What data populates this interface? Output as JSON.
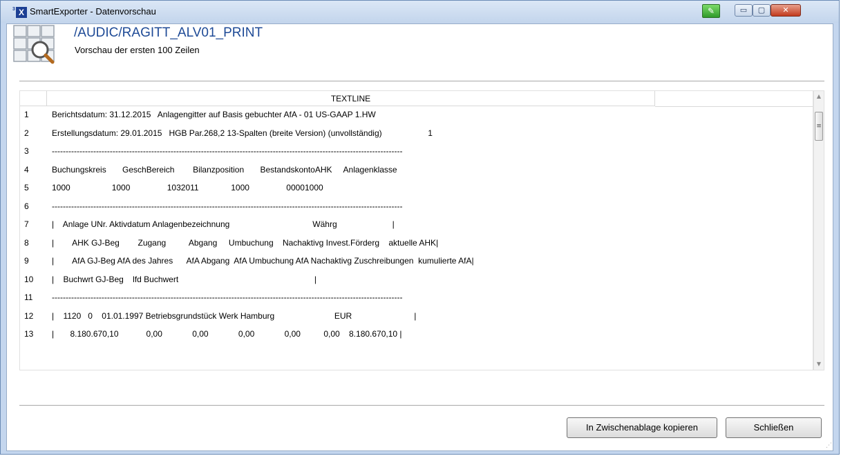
{
  "window": {
    "title": "SmartExporter - Datenvorschau",
    "icons": {
      "app": "smartexporter-logo-icon",
      "edit": "edit-green-icon"
    },
    "controls": {
      "minimize": "▭",
      "maximize": "▢",
      "close": "✕"
    }
  },
  "header": {
    "title": "/AUDIC/RAGITT_ALV01_PRINT",
    "subtitle": "Vorschau der ersten 100 Zeilen",
    "icon": "table-preview-magnifier-icon"
  },
  "grid": {
    "column_header": "TEXTLINE",
    "rows": [
      {
        "num": "1",
        "text": "Berichtsdatum: 31.12.2015   Anlagengitter auf Basis gebuchter AfA - 01 US-GAAP 1.HW"
      },
      {
        "num": "2",
        "text": "Erstellungsdatum: 29.01.2015   HGB Par.268,2 13-Spalten (breite Version) (unvollständig)                    1"
      },
      {
        "num": "3",
        "text": "-------------------------------------------------------------------------------------------------------------------------------"
      },
      {
        "num": "4",
        "text": "Buchungskreis       GeschBereich        Bilanzposition       BestandskontoAHK     Anlagenklasse"
      },
      {
        "num": "5",
        "text": "1000                  1000                1032011              1000                00001000"
      },
      {
        "num": "6",
        "text": "-------------------------------------------------------------------------------------------------------------------------------"
      },
      {
        "num": "7",
        "text": "|    Anlage UNr. Aktivdatum Anlagenbezeichnung                                    Währg                        |"
      },
      {
        "num": "8",
        "text": "|        AHK GJ-Beg        Zugang          Abgang     Umbuchung    Nachaktivg Invest.Förderg    aktuelle AHK|"
      },
      {
        "num": "9",
        "text": "|        AfA GJ-Beg AfA des Jahres      AfA Abgang  AfA Umbuchung AfA Nachaktivg Zuschreibungen  kumulierte AfA|"
      },
      {
        "num": "10",
        "text": "|    Buchwrt GJ-Beg    lfd Buchwert                                                           |"
      },
      {
        "num": "11",
        "text": "-------------------------------------------------------------------------------------------------------------------------------"
      },
      {
        "num": "12",
        "text": "|    1120   0    01.01.1997 Betriebsgrundstück Werk Hamburg                          EUR                           |"
      },
      {
        "num": "13",
        "text": "|       8.180.670,10            0,00             0,00             0,00             0,00          0,00    8.180.670,10 |"
      }
    ]
  },
  "buttons": {
    "copy": "In Zwischenablage kopieren",
    "close": "Schließen"
  },
  "scrollbar": {
    "up": "▲",
    "down": "▼",
    "thumb": "≡"
  }
}
